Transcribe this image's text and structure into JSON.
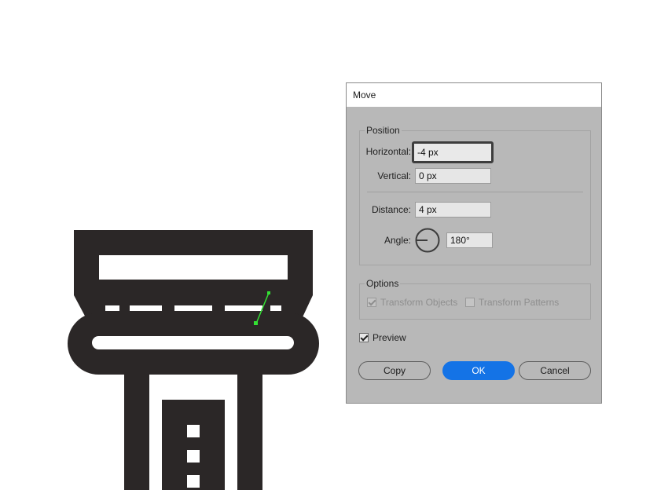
{
  "dialog": {
    "title": "Move",
    "position_legend": "Position",
    "horizontal_label": "Horizontal:",
    "horizontal_value": "-4 px",
    "vertical_label": "Vertical:",
    "vertical_value": "0 px",
    "distance_label": "Distance:",
    "distance_value": "4 px",
    "angle_label": "Angle:",
    "angle_value": "180°",
    "options_legend": "Options",
    "transform_objects_label": "Transform Objects",
    "transform_objects_checked": true,
    "transform_patterns_label": "Transform Patterns",
    "transform_patterns_checked": false,
    "preview_label": "Preview",
    "preview_checked": true,
    "copy_label": "Copy",
    "ok_label": "OK",
    "cancel_label": "Cancel"
  },
  "colors": {
    "artwork_fill": "#2b2727",
    "selection_path": "#33e033",
    "dialog_background": "#b8b8b8",
    "primary_button": "#1473e6"
  },
  "icons": {
    "angle_dial": "angle-dial-icon",
    "checkmark": "checkmark-icon"
  }
}
